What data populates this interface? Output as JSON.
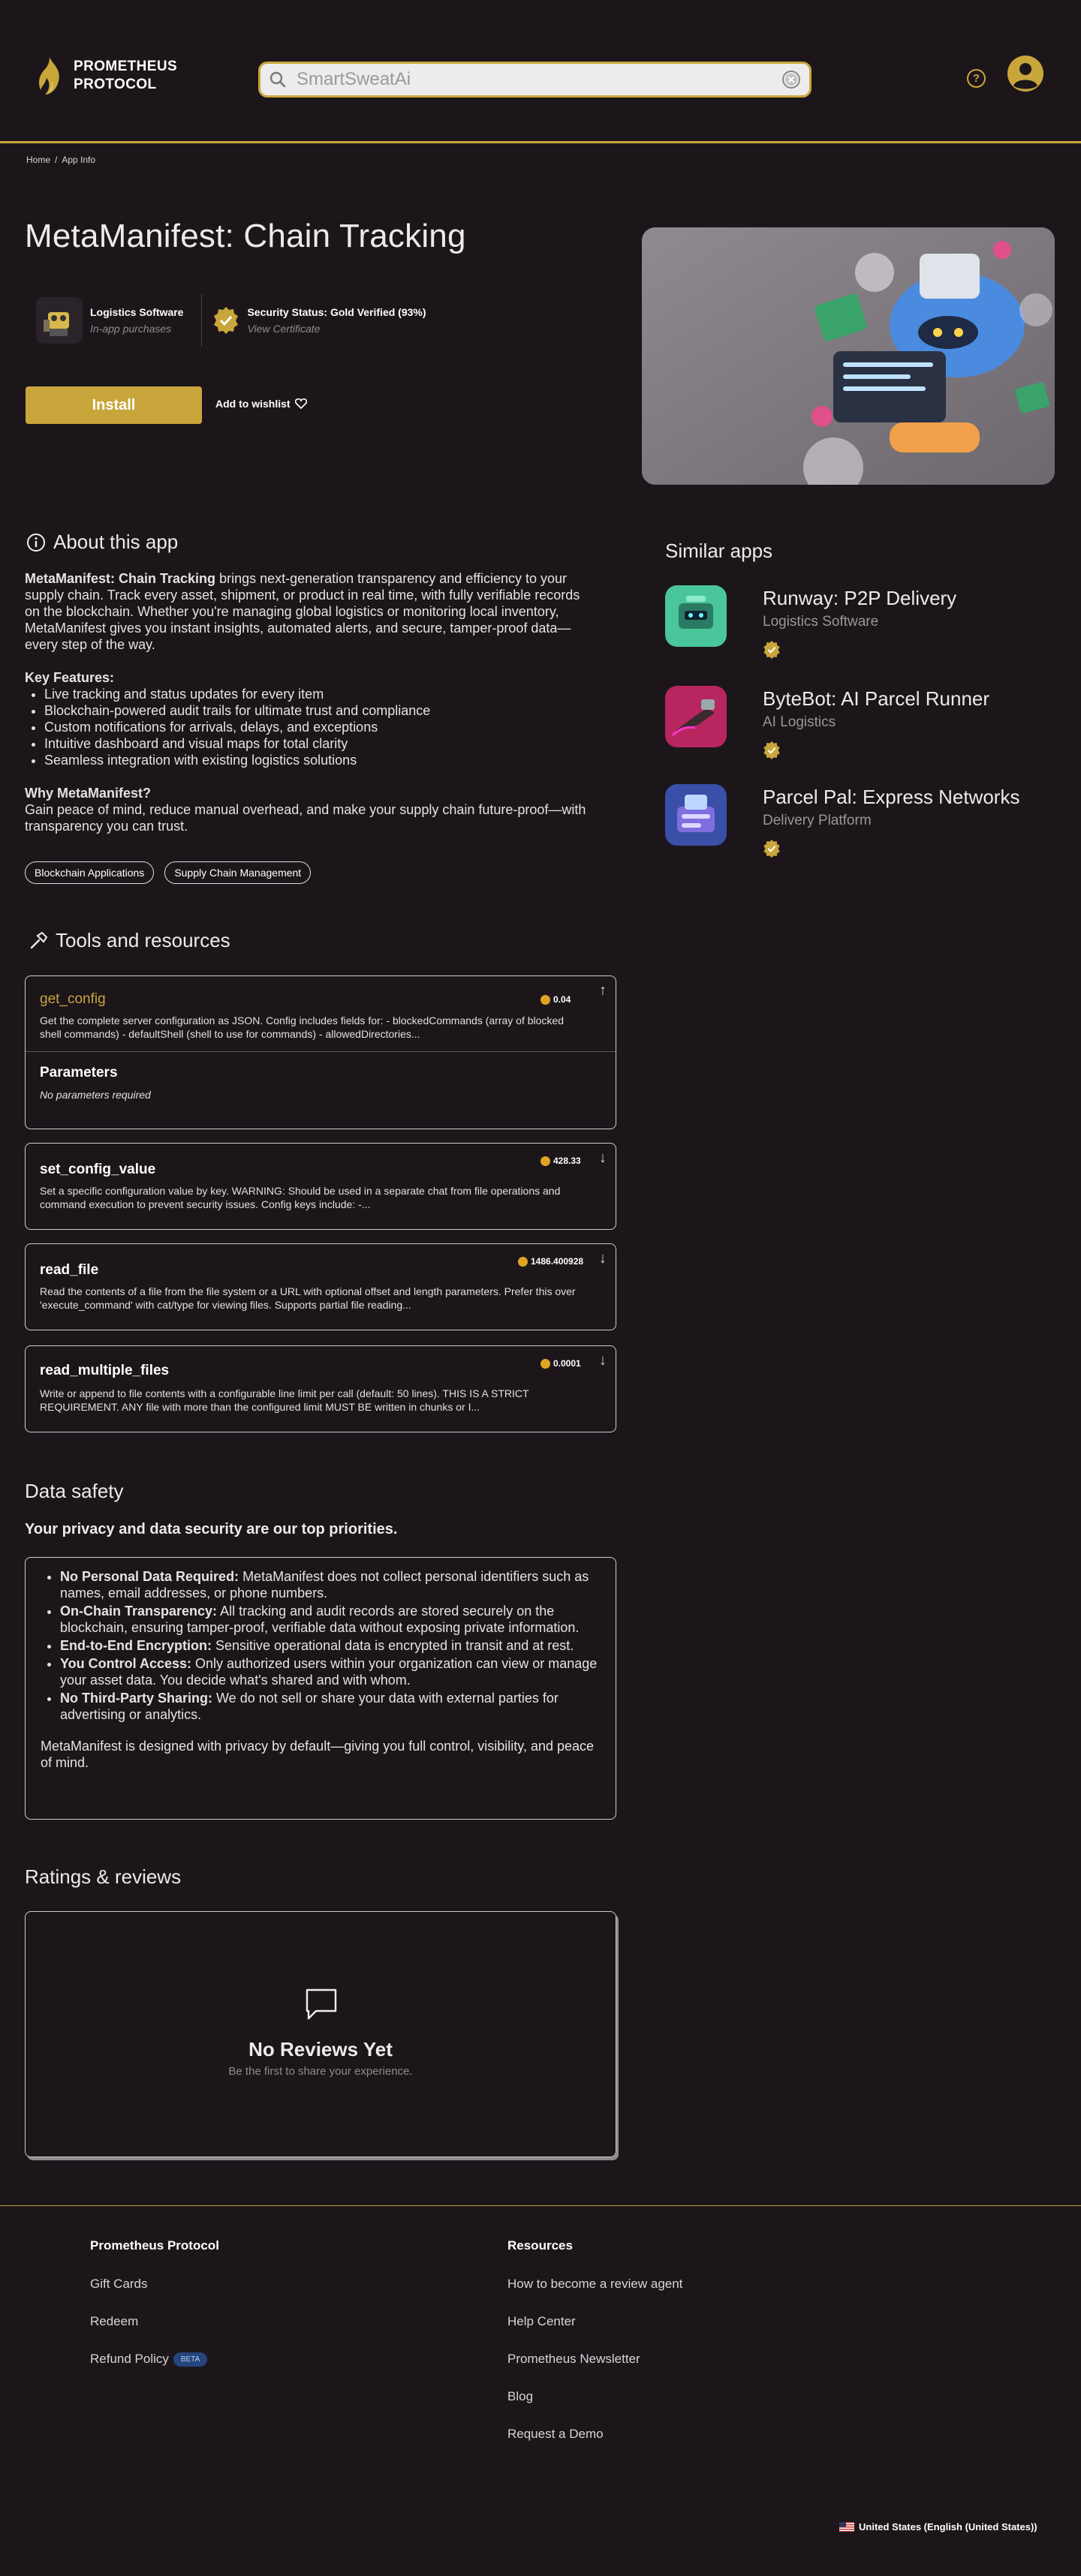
{
  "header": {
    "brand_line1": "PROMETHEUS",
    "brand_line2": "PROTOCOL",
    "search_value": "",
    "search_placeholder": "SmartSweatAi",
    "help_icon": "question-circle-icon",
    "accent_color": "#c9a63b"
  },
  "breadcrumb": [
    "Home",
    "App Info"
  ],
  "app": {
    "title": "MetaManifest: Chain Tracking",
    "category": "Logistics Software",
    "purchases": "In-app purchases",
    "security": "Security Status: Gold Verified (93%)",
    "security_link": "View Certificate",
    "install_label": "Install",
    "wishlist_label": "Add to wishlist"
  },
  "about": {
    "heading": "About this app",
    "intro_bold": "MetaManifest: Chain Tracking",
    "intro_rest": " brings next-generation transparency and efficiency to your supply chain. Track every asset, shipment, or product in real time, with fully verifiable records on the blockchain. Whether you're managing global logistics or monitoring local inventory, MetaManifest gives you instant insights, automated alerts, and secure, tamper-proof data—every step of the way.",
    "features_heading": "Key Features:",
    "features": [
      "Live tracking and status updates for every item",
      "Blockchain-powered audit trails for ultimate trust and compliance",
      "Custom notifications for arrivals, delays, and exceptions",
      "Intuitive dashboard and visual maps for total clarity",
      "Seamless integration with existing logistics solutions"
    ],
    "why_heading": "Why MetaManifest?",
    "why_text": "Gain peace of mind, reduce manual overhead, and make your supply chain future-proof—with transparency you can trust.",
    "tags": [
      "Blockchain Applications",
      "Supply Chain Management"
    ]
  },
  "similar": {
    "heading": "Similar apps",
    "items": [
      {
        "name": "Runway: P2P Delivery",
        "category": "Logistics Software"
      },
      {
        "name": "ByteBot: AI Parcel Runner",
        "category": "AI Logistics"
      },
      {
        "name": "Parcel Pal: Express Networks",
        "category": "Delivery Platform"
      }
    ]
  },
  "tools": {
    "heading": "Tools and resources",
    "items": [
      {
        "name": "get_config",
        "price": "0.04",
        "description": "Get the complete server configuration as JSON. Config includes fields for: - blockedCommands (array of blocked shell commands) - defaultShell (shell to use for commands) - allowedDirectories...",
        "expanded": true,
        "params_heading": "Parameters",
        "params_text": "No parameters required"
      },
      {
        "name": "set_config_value",
        "price": "428.33",
        "description": "Set a specific configuration value by key. WARNING: Should be used in a separate chat from file operations and command execution to prevent security issues. Config keys include: -..."
      },
      {
        "name": "read_file",
        "price": "1486.400928",
        "description": "Read the contents of a file from the file system or a URL with optional offset and length parameters. Prefer this over 'execute_command' with cat/type for viewing files. Supports partial file reading..."
      },
      {
        "name": "read_multiple_files",
        "price": "0.0001",
        "description": "Write or append to file contents with a configurable line limit per call (default: 50 lines). THIS IS A STRICT REQUIREMENT. ANY file with more than the configured limit MUST BE written in chunks or I..."
      }
    ]
  },
  "safety": {
    "heading": "Data safety",
    "subheading": "Your privacy and data security are our top priorities.",
    "items": [
      {
        "bold": "No Personal Data Required:",
        "text": " MetaManifest does not collect personal identifiers such as names, email addresses, or phone numbers."
      },
      {
        "bold": "On-Chain Transparency:",
        "text": " All tracking and audit records are stored securely on the blockchain, ensuring tamper-proof, verifiable data without exposing private information."
      },
      {
        "bold": "End-to-End Encryption:",
        "text": " Sensitive operational data is encrypted in transit and at rest."
      },
      {
        "bold": "You Control Access:",
        "text": " Only authorized users within your organization can view or manage your asset data. You decide what's shared and with whom."
      },
      {
        "bold": "No Third-Party Sharing:",
        "text": " We do not sell or share your data with external parties for advertising or analytics."
      }
    ],
    "closing": "MetaManifest is designed with privacy by default—giving you full control, visibility, and peace of mind."
  },
  "reviews": {
    "heading": "Ratings & reviews",
    "empty_title": "No Reviews Yet",
    "empty_sub": "Be the first to share your experience."
  },
  "footer": {
    "col1_heading": "Prometheus Protocol",
    "col1_links": [
      "Gift Cards",
      "Redeem",
      "Refund Policy"
    ],
    "beta_label": "BETA",
    "col2_heading": "Resources",
    "col2_links": [
      "How to become a review agent",
      "Help Center",
      "Prometheus Newsletter",
      "Blog",
      "Request a Demo"
    ],
    "locale": "United States (English (United States))"
  }
}
